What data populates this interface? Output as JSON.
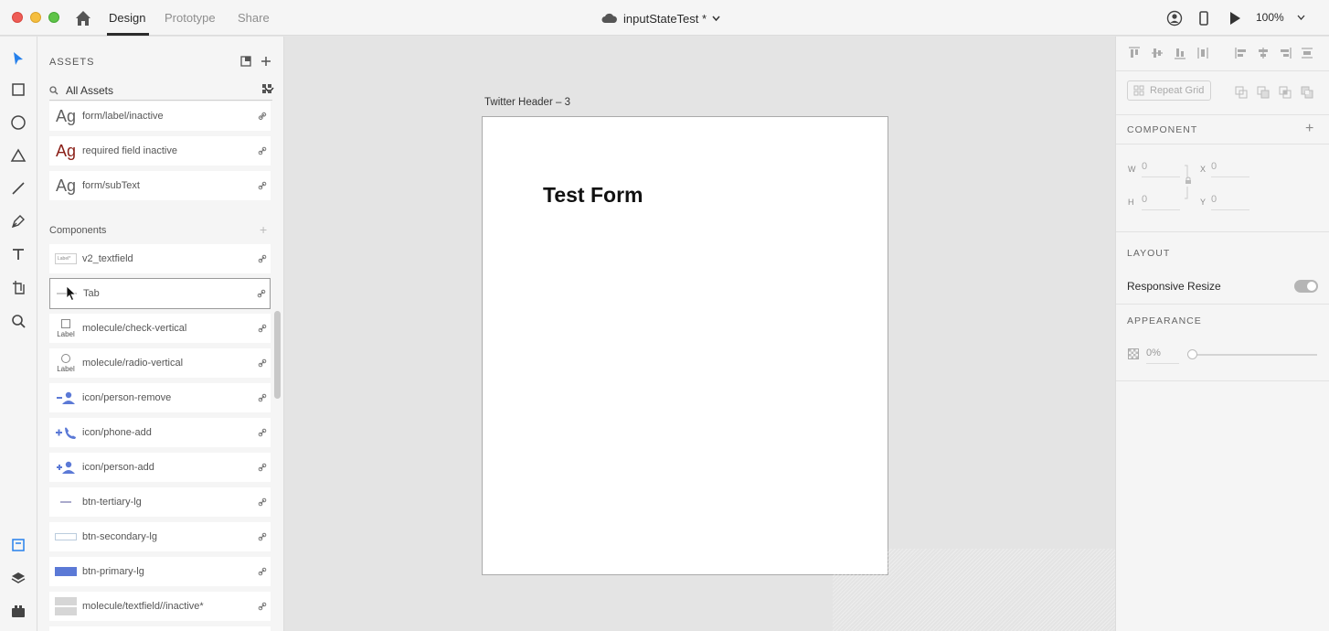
{
  "titlebar": {
    "tabs": [
      {
        "label": "Design",
        "active": true
      },
      {
        "label": "Prototype",
        "active": false
      },
      {
        "label": "Share",
        "active": false
      }
    ],
    "doc_title": "inputStateTest *",
    "zoom": "100%"
  },
  "toolbar": {
    "tools": [
      "select-tool",
      "rectangle-tool",
      "ellipse-tool",
      "polygon-tool",
      "line-tool",
      "pen-tool",
      "text-tool",
      "artboard-tool",
      "zoom-tool"
    ],
    "bottom_tools": [
      "assets-panel",
      "layers-panel",
      "plugins-panel"
    ]
  },
  "assets": {
    "title": "ASSETS",
    "filter_label": "All Assets",
    "char_styles": [
      {
        "glyph": "Ag",
        "name": "form/label/inactive",
        "color": "#606060"
      },
      {
        "glyph": "Ag",
        "name": "required field inactive",
        "color": "#8a1f17"
      },
      {
        "glyph": "Ag",
        "name": "form/subText",
        "color": "#606060"
      }
    ],
    "components_label": "Components",
    "components": [
      {
        "name": "v2_textfield",
        "thumb": "Label*"
      },
      {
        "name": "Tab",
        "thumb": ""
      },
      {
        "name": "molecule/check-vertical",
        "thumb": "Label"
      },
      {
        "name": "molecule/radio-vertical",
        "thumb": "Label"
      },
      {
        "name": "icon/person-remove",
        "thumb": ""
      },
      {
        "name": "icon/phone-add",
        "thumb": ""
      },
      {
        "name": "icon/person-add",
        "thumb": ""
      },
      {
        "name": "btn-tertiary-lg",
        "thumb": ""
      },
      {
        "name": "btn-secondary-lg",
        "thumb": ""
      },
      {
        "name": "btn-primary-lg",
        "thumb": ""
      },
      {
        "name": "molecule/textfield//inactive*",
        "thumb": ""
      }
    ]
  },
  "canvas": {
    "artboard_name": "Twitter Header – 3",
    "heading": "Test Form"
  },
  "props": {
    "repeat_grid": "Repeat Grid",
    "component_label": "COMPONENT",
    "w_label": "W",
    "w_value": "0",
    "h_label": "H",
    "h_value": "0",
    "x_label": "X",
    "x_value": "0",
    "y_label": "Y",
    "y_value": "0",
    "layout_label": "LAYOUT",
    "responsive_resize": "Responsive Resize",
    "appearance_label": "APPEARANCE",
    "opacity": "0%"
  },
  "colors": {
    "accent": "#2680eb",
    "component_icon_blue": "#5b79d6"
  }
}
